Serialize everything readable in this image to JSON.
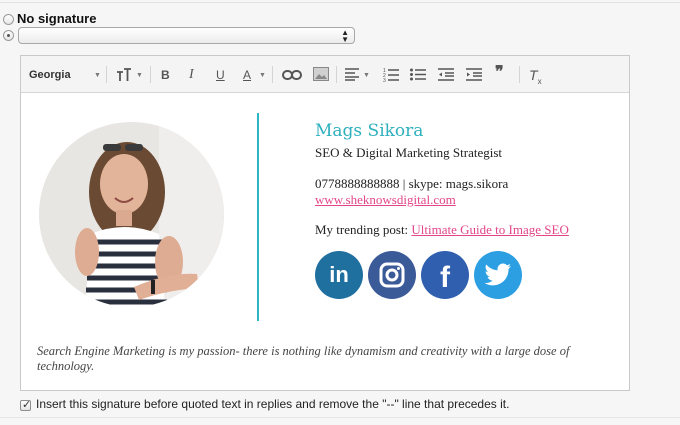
{
  "signature_picker": {
    "no_signature_label": "No signature",
    "selected_value": ""
  },
  "toolbar": {
    "font_name": "Georgia",
    "icons": [
      "text-size-icon",
      "bold-icon",
      "italic-icon",
      "underline-icon",
      "text-color-icon",
      "link-icon",
      "image-icon",
      "align-icon",
      "numbered-list-icon",
      "bulleted-list-icon",
      "indent-less-icon",
      "indent-more-icon",
      "quote-icon",
      "remove-formatting-icon"
    ]
  },
  "signature": {
    "name": "Mags Sikora",
    "title": "SEO & Digital Marketing Strategist",
    "phone_skype": "0778888888888 | skype: mags.sikora",
    "website": "www.sheknowsdigital.com",
    "post_prefix": "My trending post: ",
    "post_link": "Ultimate Guide to Image SEO",
    "quote": "Search Engine Marketing is my passion- there is nothing like dynamism and creativity with a large dose of technology.",
    "social": [
      {
        "name": "linkedin-icon",
        "label": "in",
        "color": "#1f6f9f"
      },
      {
        "name": "instagram-icon",
        "label": "",
        "color": "#3b5a98"
      },
      {
        "name": "facebook-icon",
        "label": "f",
        "color": "#2f5fae"
      },
      {
        "name": "twitter-icon",
        "label": "",
        "color": "#2c9fe3"
      }
    ],
    "accent_color": "#2eb0bd",
    "link_color": "#e2458a"
  },
  "options": {
    "insert_before_quoted_label": "Insert this signature before quoted text in replies and remove the \"--\" line that precedes it.",
    "insert_before_quoted_checked": true
  }
}
